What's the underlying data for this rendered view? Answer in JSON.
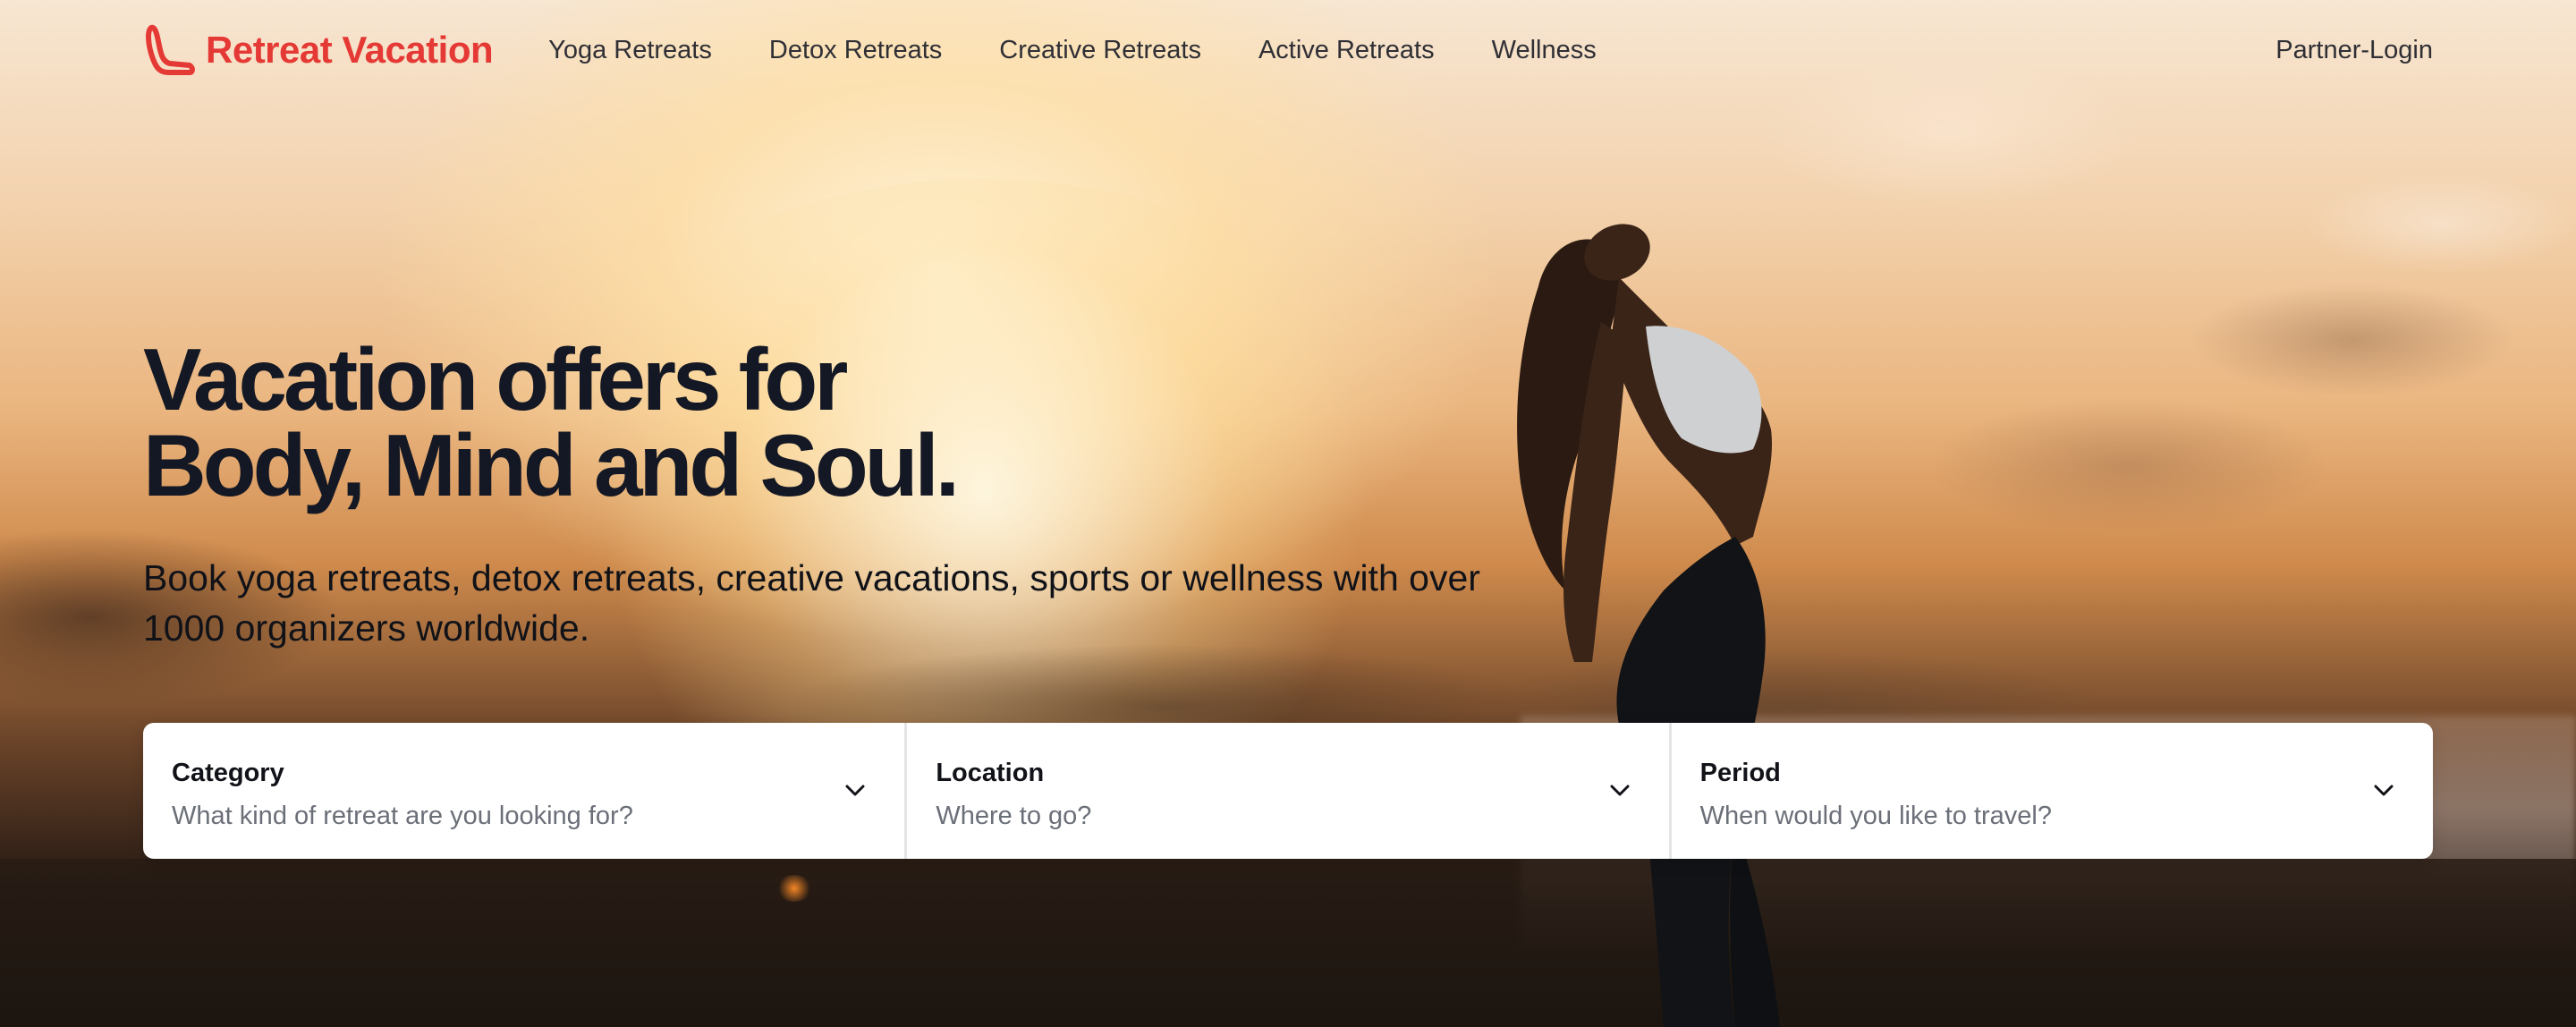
{
  "brand": {
    "name": "Retreat Vacation",
    "color": "#e53935"
  },
  "nav": {
    "links": [
      {
        "label": "Yoga Retreats"
      },
      {
        "label": "Detox Retreats"
      },
      {
        "label": "Creative Retreats"
      },
      {
        "label": "Active Retreats"
      },
      {
        "label": "Wellness"
      }
    ],
    "partner_login": "Partner-Login"
  },
  "hero": {
    "headline_line1": "Vacation offers for",
    "headline_line2": "Body, Mind and Soul.",
    "subtitle": "Book yoga retreats, detox retreats, creative vacations, sports or wellness with over 1000 organizers worldwide."
  },
  "search": {
    "fields": [
      {
        "label": "Category",
        "placeholder": "What kind of retreat are you looking for?",
        "icon": "chevron-down-icon"
      },
      {
        "label": "Location",
        "placeholder": "Where to go?",
        "icon": "chevron-down-icon"
      },
      {
        "label": "Period",
        "placeholder": "When would you like to travel?",
        "icon": "chevron-down-icon"
      }
    ]
  }
}
